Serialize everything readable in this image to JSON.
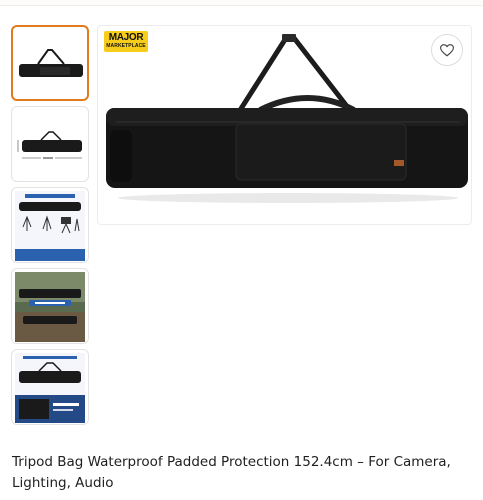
{
  "badge": {
    "line1": "MAJOR",
    "line2": "MARKETPLACE",
    "color": "#f6cd1b"
  },
  "thumbnails": [
    {
      "name": "thumb-1",
      "selected": true
    },
    {
      "name": "thumb-2",
      "selected": false
    },
    {
      "name": "thumb-3",
      "selected": false,
      "caption": "Fits for Different Stands"
    },
    {
      "name": "thumb-4",
      "selected": false,
      "caption": "EASY TO CARRY"
    },
    {
      "name": "thumb-5",
      "selected": false,
      "caption": "Exterior Pocket for Placing Cables"
    }
  ],
  "accent_color": "#e07c1e",
  "favorite_icon": "heart-icon",
  "product": {
    "title": "Tripod Bag Waterproof Padded Protection 152.4cm – For Camera, Lighting, Audio"
  }
}
